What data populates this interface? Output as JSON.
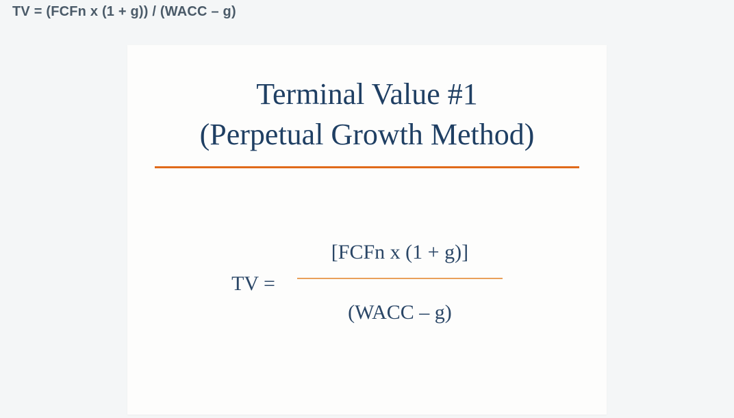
{
  "top_formula": "TV  =  (FCFn x (1 + g))  /  (WACC – g)",
  "card": {
    "title_line1": "Terminal Value #1",
    "title_line2": "(Perpetual Growth Method)",
    "formula": {
      "lhs": "TV =",
      "numerator": "[FCFn  x  (1 + g)]",
      "denominator": "(WACC – g)"
    }
  }
}
